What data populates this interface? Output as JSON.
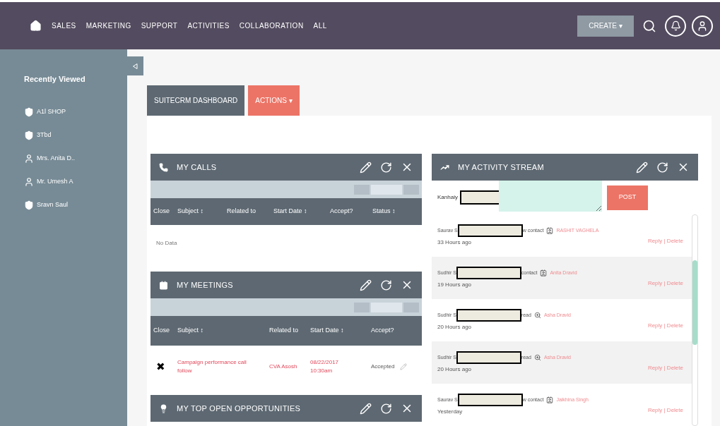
{
  "nav": {
    "items": [
      "SALES",
      "MARKETING",
      "SUPPORT",
      "ACTIVITIES",
      "COLLABORATION",
      "ALL"
    ],
    "create": "CREATE ▾"
  },
  "sidebar": {
    "title": "Recently Viewed",
    "items": [
      {
        "label": "A1l SHOP",
        "kind": "account"
      },
      {
        "label": "3Tbd",
        "kind": "account"
      },
      {
        "label": "Mrs. Anita D..",
        "kind": "contact"
      },
      {
        "label": "Mr. Umesh A",
        "kind": "contact"
      },
      {
        "label": "Sravn Saul",
        "kind": "account"
      }
    ]
  },
  "tabs": [
    {
      "label": "SUITECRM DASHBOARD",
      "selected": false
    },
    {
      "label": "ACTIONS ▾",
      "selected": true
    }
  ],
  "calls": {
    "title": "MY CALLS",
    "columns": [
      "Close",
      "Subject ↕",
      "Related to",
      "Start Date ↕",
      "Accept?",
      "Status ↕"
    ],
    "empty": "No Data"
  },
  "meetings": {
    "title": "MY MEETINGS",
    "columns": [
      "Close",
      "Subject ↕",
      "Related to",
      "Start Date ↕",
      "Accept?"
    ],
    "rows": [
      {
        "close": "✖",
        "subject": "Campaign performance call follow",
        "related": "CVA Asosh",
        "date": "08/22/2017 10:30am",
        "accept": "Accepted"
      }
    ]
  },
  "opportunities": {
    "title": "MY TOP OPEN OPPORTUNITIES"
  },
  "activity": {
    "title": "MY ACTIVITY STREAM",
    "user": "Kanhaiy",
    "post": "POST",
    "items": [
      {
        "prefix": "Saurav S",
        "suffix": "w contact",
        "kind": "contact",
        "link": "RASHIT VAGHELA",
        "time": "33 Hours ago",
        "actions": "Reply | Delete"
      },
      {
        "prefix": "Sudhir S",
        "suffix": "contact",
        "kind": "contact",
        "link": "Anita Dravid",
        "time": "19 Hours ago",
        "actions": "Reply | Delete"
      },
      {
        "prefix": "Sudhir S",
        "suffix": "read",
        "kind": "view",
        "link": "Asha Dravid",
        "time": "20 Hours ago",
        "actions": "Reply | Delete"
      },
      {
        "prefix": "Sudhir S",
        "suffix": "read",
        "kind": "view",
        "link": "Asha Dravid",
        "time": "20 Hours ago",
        "actions": "Reply | Delete"
      },
      {
        "prefix": "Saurav S",
        "suffix": "w contact",
        "kind": "contact",
        "link": "Jaikhina Singh",
        "time": "Yesterday",
        "actions": "Reply | Delete"
      }
    ]
  }
}
